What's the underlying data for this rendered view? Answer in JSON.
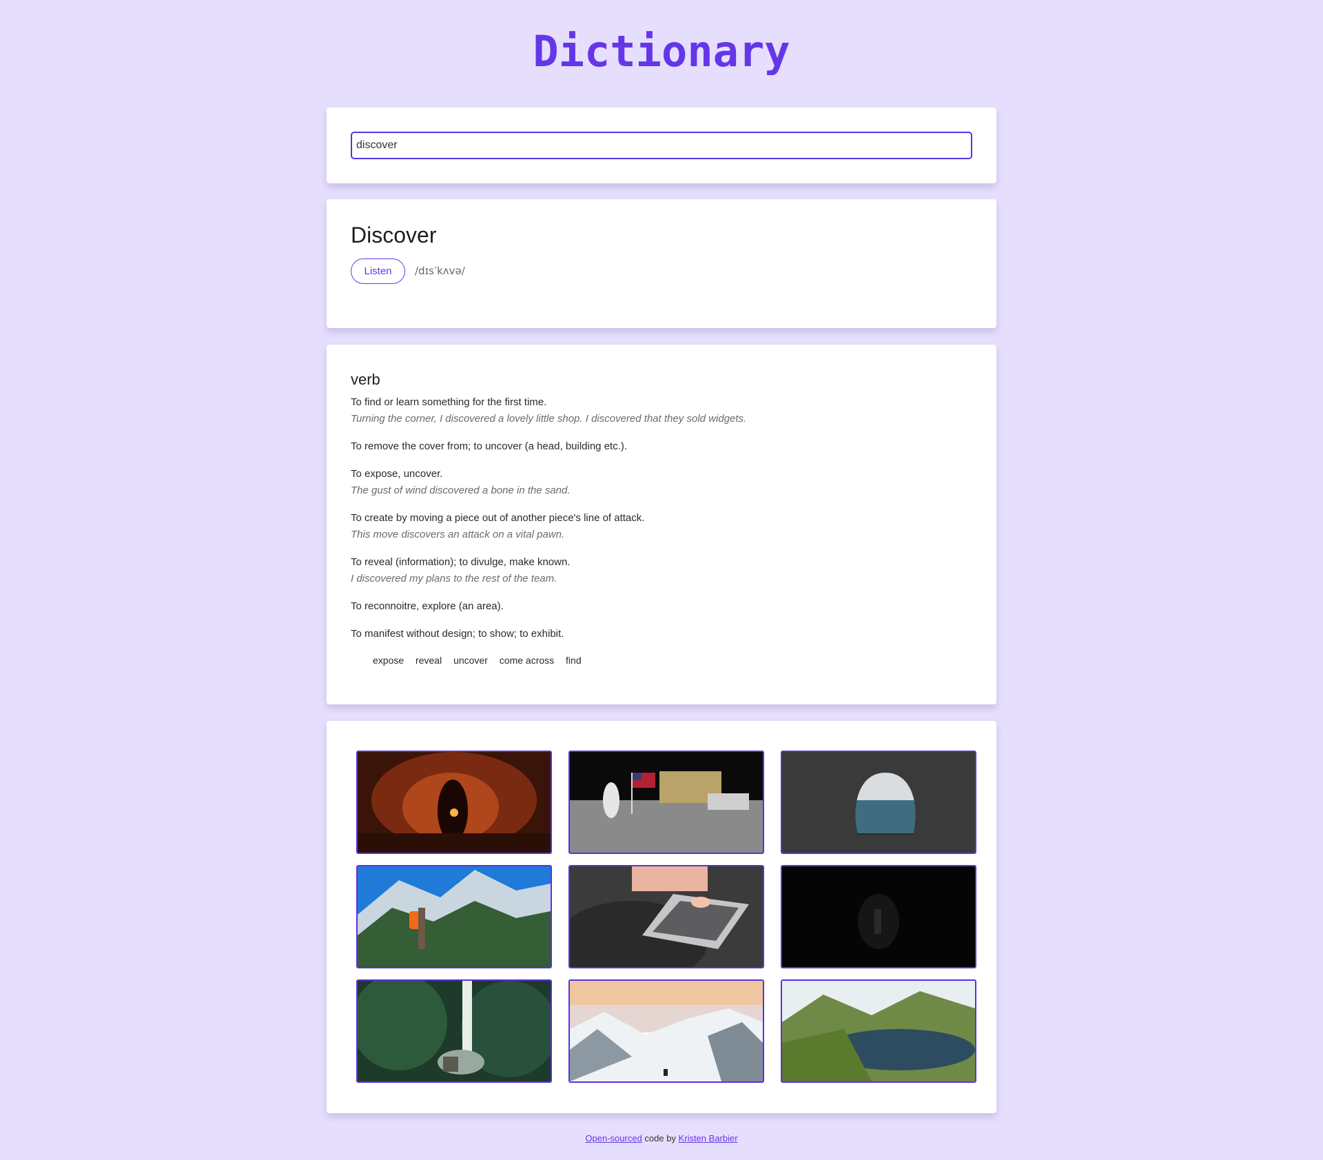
{
  "header": {
    "title": "Dictionary"
  },
  "search": {
    "value": "discover"
  },
  "word": {
    "headword": "Discover",
    "listen_label": "Listen",
    "phonetic": "/dɪsˈkʌvə/"
  },
  "meaning": {
    "part_of_speech": "verb",
    "definitions": [
      {
        "text": "To find or learn something for the first time.",
        "example": "Turning the corner, I discovered a lovely little shop. I discovered that they sold widgets."
      },
      {
        "text": "To remove the cover from; to uncover (a head, building etc.).",
        "example": ""
      },
      {
        "text": "To expose, uncover.",
        "example": "The gust of wind discovered a bone in the sand."
      },
      {
        "text": "To create by moving a piece out of another piece's line of attack.",
        "example": "This move discovers an attack on a vital pawn."
      },
      {
        "text": "To reveal (information); to divulge, make known.",
        "example": "I discovered my plans to the rest of the team."
      },
      {
        "text": "To reconnoitre, explore (an area).",
        "example": ""
      },
      {
        "text": "To manifest without design; to show; to exhibit.",
        "example": ""
      }
    ],
    "synonyms": [
      "expose",
      "reveal",
      "uncover",
      "come across",
      "find"
    ]
  },
  "photos": [
    {
      "name": "photo-cave-torch"
    },
    {
      "name": "photo-moon-landing"
    },
    {
      "name": "photo-sea-cave"
    },
    {
      "name": "photo-mountain-hiker"
    },
    {
      "name": "photo-laptop-typing"
    },
    {
      "name": "photo-dark-cave"
    },
    {
      "name": "photo-waterfall-forest"
    },
    {
      "name": "photo-snowy-peaks"
    },
    {
      "name": "photo-green-lake"
    }
  ],
  "footer": {
    "link1": "Open-sourced",
    "middle": " code by ",
    "link2": "Kristen Barbier"
  },
  "colors": {
    "accent": "#6536e8",
    "background": "#e6defd",
    "card": "#ffffff"
  }
}
